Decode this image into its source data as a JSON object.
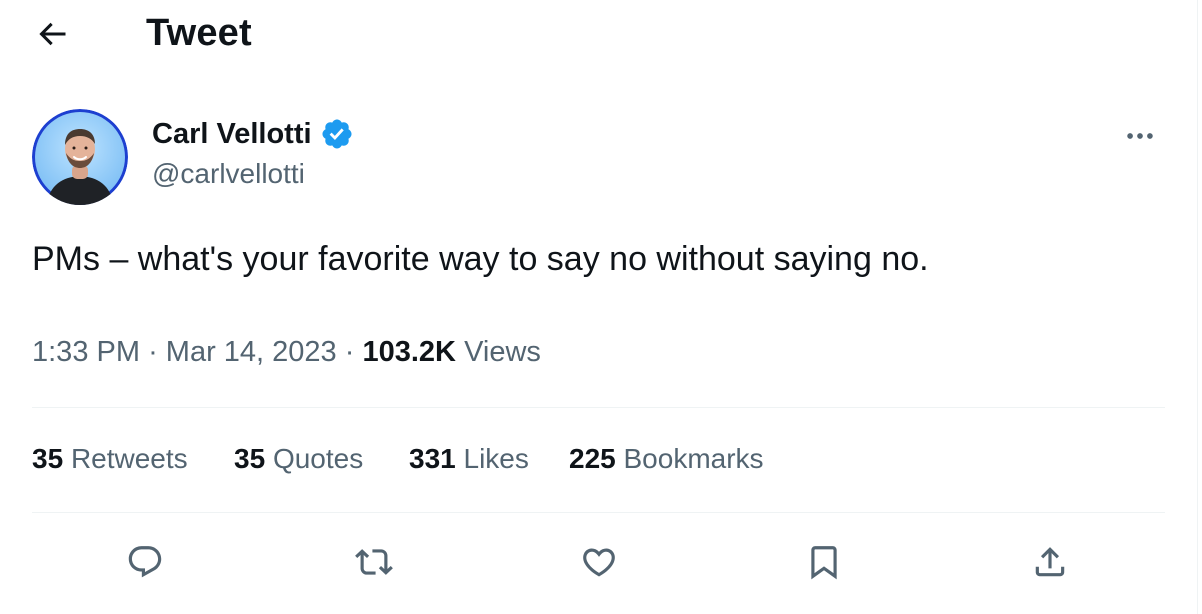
{
  "header": {
    "title": "Tweet",
    "back_icon": "arrow-left-icon"
  },
  "author": {
    "name": "Carl Vellotti",
    "handle": "@carlvellotti",
    "verified_icon": "verified-badge-icon",
    "verified_color": "#1d9bf0"
  },
  "tweet": {
    "text": "PMs – what's your favorite way to say no without saying no."
  },
  "meta": {
    "time": "1:33 PM",
    "separator": "·",
    "date": "Mar 14, 2023",
    "views_count": "103.2K",
    "views_label": "Views"
  },
  "stats": {
    "retweets": {
      "count": "35",
      "label": "Retweets"
    },
    "quotes": {
      "count": "35",
      "label": "Quotes"
    },
    "likes": {
      "count": "331",
      "label": "Likes"
    },
    "bookmarks": {
      "count": "225",
      "label": "Bookmarks"
    }
  },
  "actions": [
    "reply-icon",
    "retweet-icon",
    "like-icon",
    "bookmark-icon",
    "share-icon"
  ],
  "colors": {
    "text_primary": "#0f1419",
    "text_secondary": "#536471",
    "divider": "#eff3f4",
    "avatar_ring": "#1d4ed8"
  }
}
